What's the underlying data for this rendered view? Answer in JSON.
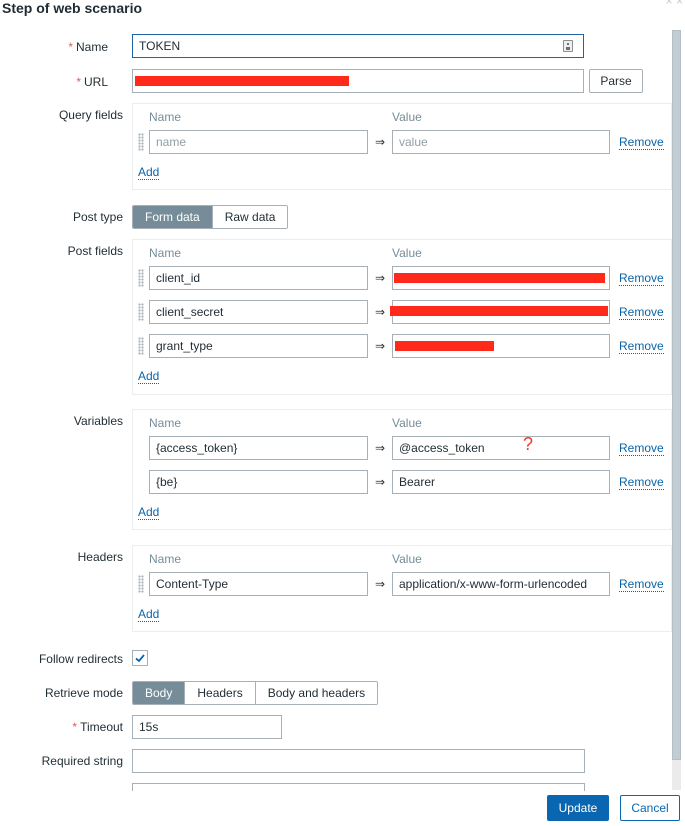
{
  "dialog": {
    "title": "Step of web scenario"
  },
  "form": {
    "name": {
      "label": "Name",
      "required": "*",
      "value": "TOKEN"
    },
    "url": {
      "label": "URL",
      "required": "*",
      "value": "",
      "parse_label": "Parse"
    },
    "query_fields": {
      "label": "Query fields",
      "col_name": "Name",
      "col_value": "Value",
      "rows": [
        {
          "name_placeholder": "name",
          "value_placeholder": "value",
          "arrow": "⇒",
          "remove": "Remove"
        }
      ],
      "add": "Add"
    },
    "post_type": {
      "label": "Post type",
      "options": [
        "Form data",
        "Raw data"
      ],
      "selected": "Form data"
    },
    "post_fields": {
      "label": "Post fields",
      "col_name": "Name",
      "col_value": "Value",
      "rows": [
        {
          "name": "client_id",
          "value": "[redacted]",
          "arrow": "⇒",
          "remove": "Remove"
        },
        {
          "name": "client_secret",
          "value": "[redacted]",
          "arrow": "⇒",
          "remove": "Remove"
        },
        {
          "name": "grant_type",
          "value": "[redacted]",
          "arrow": "⇒",
          "remove": "Remove"
        }
      ],
      "add": "Add"
    },
    "variables": {
      "label": "Variables",
      "col_name": "Name",
      "col_value": "Value",
      "rows": [
        {
          "name": "{access_token}",
          "value": "@access_token",
          "arrow": "⇒",
          "remove": "Remove",
          "annotation": "?"
        },
        {
          "name": "{be}",
          "value": "Bearer",
          "arrow": "⇒",
          "remove": "Remove"
        }
      ],
      "add": "Add"
    },
    "headers": {
      "label": "Headers",
      "col_name": "Name",
      "col_value": "Value",
      "rows": [
        {
          "name": "Content-Type",
          "value": "application/x-www-form-urlencoded",
          "arrow": "⇒",
          "remove": "Remove"
        }
      ],
      "add": "Add"
    },
    "follow_redirects": {
      "label": "Follow redirects",
      "checked": true
    },
    "retrieve_mode": {
      "label": "Retrieve mode",
      "options": [
        "Body",
        "Headers",
        "Body and headers"
      ],
      "selected": "Body"
    },
    "timeout": {
      "label": "Timeout",
      "required": "*",
      "value": "15s"
    },
    "required_string": {
      "label": "Required string",
      "value": ""
    }
  },
  "footer": {
    "update": "Update",
    "cancel": "Cancel"
  },
  "colors": {
    "primary": "#0a66b0",
    "segment_active": "#768d99",
    "required": "#e45959",
    "redaction": "#ff2a1a"
  }
}
